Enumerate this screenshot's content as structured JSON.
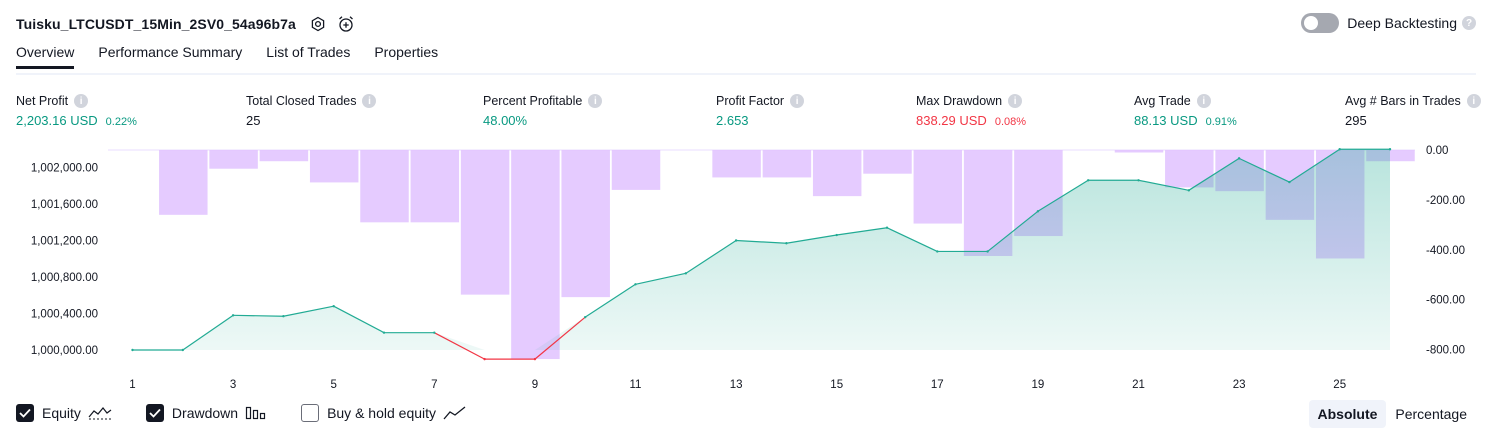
{
  "header": {
    "strategy_name": "Tuisku_LTCUSDT_15Min_2SV0_54a96b7a",
    "settings_icon": "gear-icon",
    "alert_icon": "alarm-clock-plus-icon",
    "deep_backtesting_label": "Deep Backtesting",
    "deep_backtesting_on": false,
    "help_glyph": "?"
  },
  "tabs": [
    {
      "label": "Overview",
      "active": true
    },
    {
      "label": "Performance Summary",
      "active": false
    },
    {
      "label": "List of Trades",
      "active": false
    },
    {
      "label": "Properties",
      "active": false
    }
  ],
  "metrics": {
    "net_profit": {
      "label": "Net Profit",
      "value": "2,203.16 USD",
      "pct": "0.22%"
    },
    "total_closed_trades": {
      "label": "Total Closed Trades",
      "value": "25"
    },
    "percent_profitable": {
      "label": "Percent Profitable",
      "value": "48.00%"
    },
    "profit_factor": {
      "label": "Profit Factor",
      "value": "2.653"
    },
    "max_drawdown": {
      "label": "Max Drawdown",
      "value": "838.29 USD",
      "pct": "0.08%"
    },
    "avg_trade": {
      "label": "Avg Trade",
      "value": "88.13 USD",
      "pct": "0.91%"
    },
    "avg_bars": {
      "label": "Avg # Bars in Trades",
      "value": "295"
    },
    "info_glyph": "i"
  },
  "colors": {
    "equity_line": "#22ab94",
    "equity_fill": "#22ab94",
    "equity_negative": "#f23645",
    "drawdown_fill": "#e1c2ff",
    "positive": "#089981",
    "negative": "#f23645"
  },
  "chart_data": {
    "type": "area",
    "x": [
      1,
      2,
      3,
      4,
      5,
      6,
      7,
      8,
      9,
      10,
      11,
      12,
      13,
      14,
      15,
      16,
      17,
      18,
      19,
      20,
      21,
      22,
      23,
      24,
      25,
      26
    ],
    "x_ticks": [
      1,
      3,
      5,
      7,
      9,
      11,
      13,
      15,
      17,
      19,
      21,
      23,
      25
    ],
    "series": [
      {
        "name": "Equity",
        "axis": "left",
        "values": [
          1000000,
          1000000,
          1000380,
          1000370,
          1000480,
          1000190,
          1000190,
          999900,
          999900,
          1000360,
          1000720,
          1000840,
          1001200,
          1001170,
          1001260,
          1001340,
          1001080,
          1001080,
          1001520,
          1001860,
          1001860,
          1001750,
          1002100,
          1001840,
          1002200,
          1002200
        ]
      },
      {
        "name": "Drawdown",
        "axis": "right",
        "values": [
          0,
          -260,
          -75,
          -45,
          -130,
          -290,
          -290,
          -580,
          -838.29,
          -590,
          -160,
          0,
          -110,
          -110,
          -185,
          -95,
          -295,
          -425,
          -345,
          0,
          -10,
          -150,
          -165,
          -280,
          -435,
          -45
        ]
      }
    ],
    "y_left": {
      "ticks": [
        1000000,
        1000400,
        1000800,
        1001200,
        1001600,
        1002000
      ],
      "tick_labels": [
        "1,000,000.00",
        "1,000,400.00",
        "1,000,800.00",
        "1,001,200.00",
        "1,001,600.00",
        "1,002,000.00"
      ],
      "range": [
        999880,
        1002200
      ]
    },
    "y_right": {
      "ticks": [
        0,
        -200,
        -400,
        -600,
        -800
      ],
      "tick_labels": [
        "0.00",
        "-200.00",
        "-400.00",
        "-600.00",
        "-800.00"
      ],
      "range": [
        -840,
        0
      ]
    },
    "grid": false
  },
  "legend": {
    "equity": {
      "label": "Equity",
      "checked": true,
      "icon": "equity-line-icon"
    },
    "drawdown": {
      "label": "Drawdown",
      "checked": true,
      "icon": "drawdown-bars-icon"
    },
    "buy_hold": {
      "label": "Buy & hold equity",
      "checked": false,
      "icon": "buy-hold-line-icon"
    }
  },
  "modes": [
    {
      "label": "Absolute",
      "active": true
    },
    {
      "label": "Percentage",
      "active": false
    }
  ]
}
